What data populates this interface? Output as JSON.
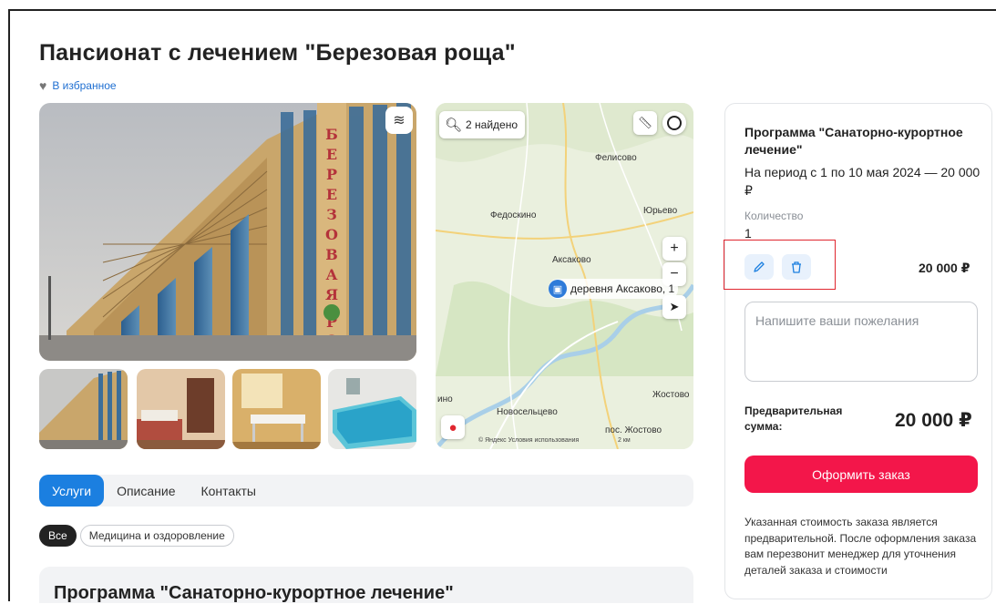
{
  "hotel": {
    "title": "Пансионат с лечением \"Березовая роща\"",
    "favorite_label": "В избранное"
  },
  "gallery": {
    "main_photo": "building-photo",
    "thumbnails": [
      "building-thumb",
      "room-thumb",
      "medical-room-thumb",
      "bath-thumb"
    ],
    "sign_text": "БЕРЕЗОВАЯ РОЩА"
  },
  "map": {
    "search_label": "2 найдено",
    "places": [
      "Фелисово",
      "Федоскино",
      "Юрьево",
      "Аксаково",
      "Жостово",
      "Новосельцево",
      "пос. Жостово",
      "ино"
    ],
    "pin_label": "деревня Аксаково, 1",
    "copyright": "© Яндекс  Условия использования",
    "scale": "2 км",
    "zoom_in": "+",
    "zoom_out": "−"
  },
  "tabs": [
    {
      "label": "Услуги",
      "active": true
    },
    {
      "label": "Описание",
      "active": false
    },
    {
      "label": "Контакты",
      "active": false
    }
  ],
  "chips": [
    {
      "label": "Все",
      "active": true
    },
    {
      "label": "Медицина и оздоровление",
      "active": false
    }
  ],
  "program_section": {
    "title": "Программа \"Санаторно-курортное лечение\""
  },
  "order": {
    "program_title": "Программа \"Санаторно-курортное лечение\"",
    "period": "На период с 1 по 10 мая 2024 — 20 000 ₽",
    "qty_label": "Количество",
    "qty_value": "1",
    "line_price": "20 000 ₽",
    "wish_placeholder": "Напишите ваши пожелания",
    "pre_total_label": "Предварительная сумма:",
    "pre_total_value": "20 000 ₽",
    "submit_label": "Оформить заказ",
    "note": "Указанная стоимость заказа является предварительной. После оформления заказа вам перезвонит менеджер для уточнения деталей заказа и стоимости"
  },
  "colors": {
    "accent_blue": "#1b7fe0",
    "order_red": "#f3164a",
    "highlight_box": "#e0262f"
  }
}
